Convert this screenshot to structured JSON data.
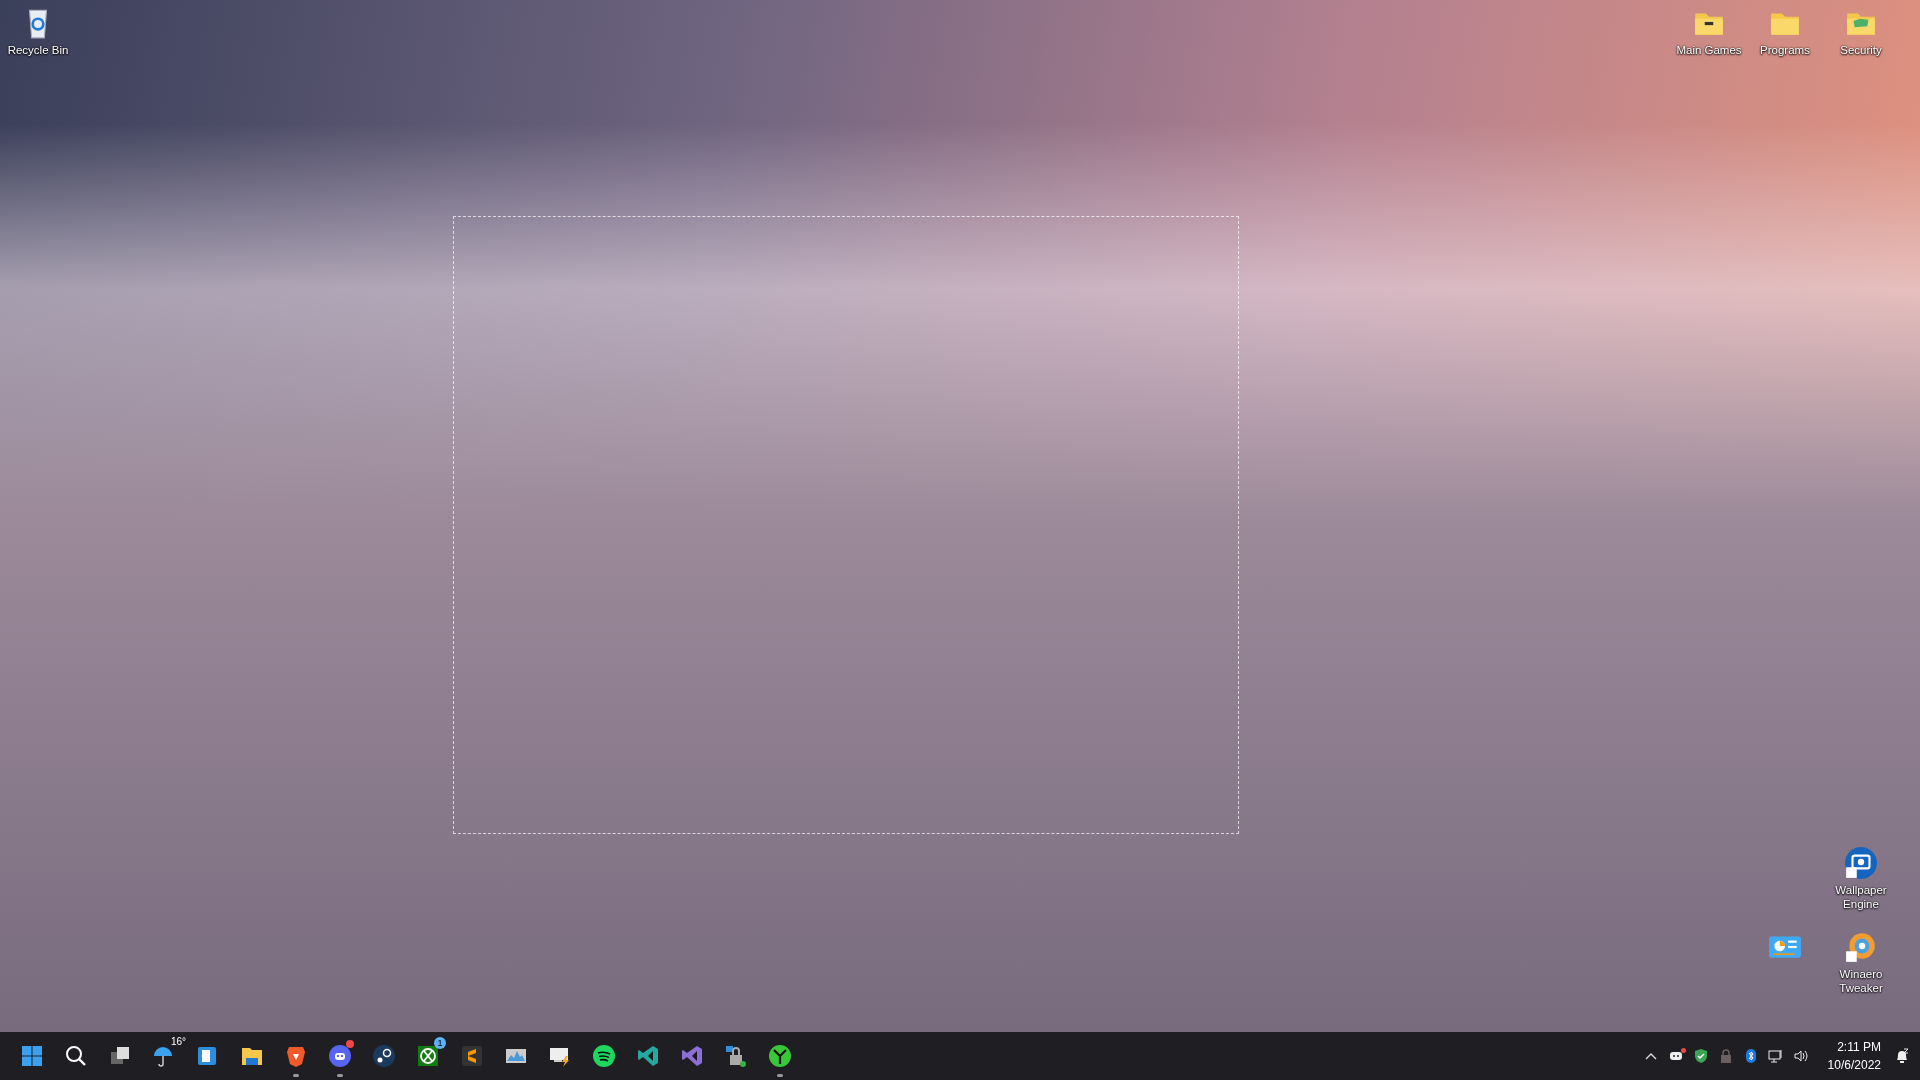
{
  "desktop": {
    "icons_top_left": [
      {
        "kind": "recycle-bin",
        "label": "Recycle Bin"
      }
    ],
    "icons_top_right": [
      {
        "kind": "folder-games",
        "label": "Main Games"
      },
      {
        "kind": "folder",
        "label": "Programs"
      },
      {
        "kind": "folder-security",
        "label": "Security"
      }
    ],
    "icons_bottom_right": [
      {
        "icons": [
          {
            "kind": "wallpaper-engine",
            "label": "Wallpaper Engine"
          }
        ]
      },
      {
        "icons": [
          {
            "kind": "control-panel"
          },
          {
            "kind": "winaero",
            "label": "Winaero Tweaker"
          }
        ]
      }
    ]
  },
  "taskbar": {
    "apps": [
      {
        "kind": "start",
        "running": false
      },
      {
        "kind": "search",
        "running": false
      },
      {
        "kind": "task-view",
        "running": false
      },
      {
        "kind": "weather",
        "running": false,
        "badge": "16°"
      },
      {
        "kind": "widget-app",
        "running": false
      },
      {
        "kind": "files",
        "running": false
      },
      {
        "kind": "brave",
        "running": true
      },
      {
        "kind": "discord",
        "running": true,
        "alert": true
      },
      {
        "kind": "steam",
        "running": false
      },
      {
        "kind": "xbox",
        "running": false,
        "badge": "1"
      },
      {
        "kind": "sublime",
        "running": false
      },
      {
        "kind": "monitor",
        "running": false
      },
      {
        "kind": "remote",
        "running": false
      },
      {
        "kind": "spotify",
        "running": false
      },
      {
        "kind": "vscode",
        "running": false
      },
      {
        "kind": "visual-studio",
        "running": false
      },
      {
        "kind": "lock-app",
        "running": false
      },
      {
        "kind": "tree-app",
        "running": true
      }
    ],
    "tray": [
      {
        "kind": "chevron"
      },
      {
        "kind": "discord",
        "alert": true
      },
      {
        "kind": "shield"
      },
      {
        "kind": "lock"
      },
      {
        "kind": "bluetooth"
      },
      {
        "kind": "network"
      },
      {
        "kind": "volume"
      }
    ],
    "clock": {
      "time": "2:11 PM",
      "date": "10/6/2022"
    },
    "notifications": {
      "kind": "bell-snooze"
    }
  }
}
